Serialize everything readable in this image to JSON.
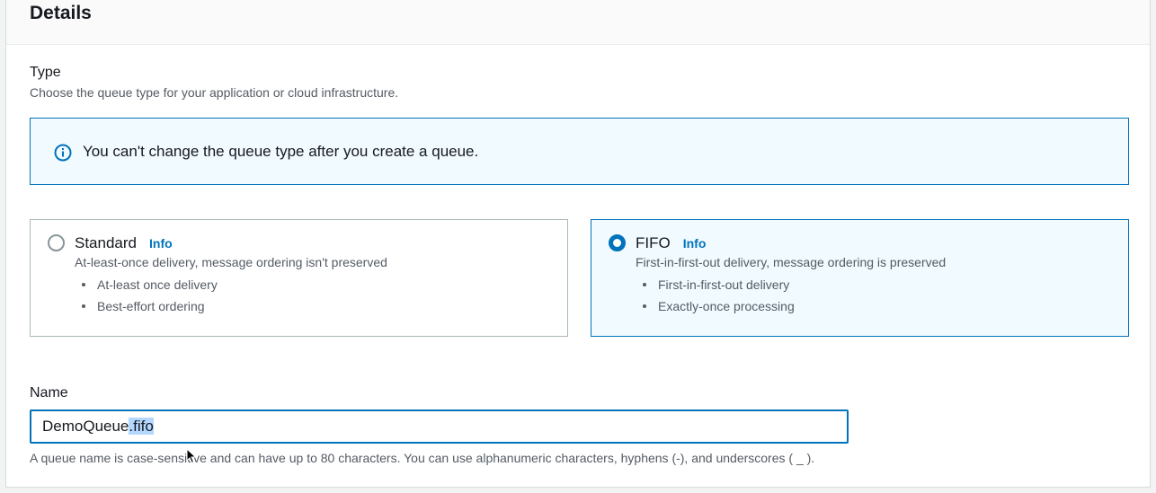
{
  "details": {
    "title": "Details"
  },
  "type_section": {
    "label": "Type",
    "description": "Choose the queue type for your application or cloud infrastructure."
  },
  "alert": {
    "icon": "info-circle-icon",
    "message": "You can't change the queue type after you create a queue."
  },
  "queue_types": [
    {
      "title": "Standard",
      "info": "Info",
      "description": "At-least-once delivery, message ordering isn't preserved",
      "bullets": [
        "At-least once delivery",
        "Best-effort ordering"
      ],
      "selected": false
    },
    {
      "title": "FIFO",
      "info": "Info",
      "description": "First-in-first-out delivery, message ordering is preserved",
      "bullets": [
        "First-in-first-out delivery",
        "Exactly-once processing"
      ],
      "selected": true
    }
  ],
  "name_field": {
    "label": "Name",
    "value_prefix": "DemoQueue",
    "value_selected": ".fifo",
    "hint": "A queue name is case-sensitive and can have up to 80 characters. You can use alphanumeric characters, hyphens (-), and underscores ( _ )."
  },
  "colors": {
    "accent": "#0073bb",
    "selected_bg": "#f1faff",
    "text_secondary": "#545b64"
  }
}
